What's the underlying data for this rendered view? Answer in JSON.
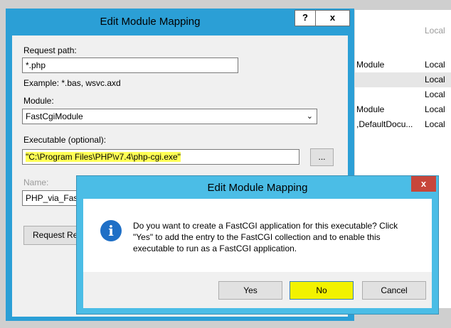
{
  "background_window": {
    "header": "Local",
    "rows": [
      {
        "c1": "Module",
        "c2": "Local"
      },
      {
        "c1": "",
        "c2": "Local"
      },
      {
        "c1": "",
        "c2": "Local"
      },
      {
        "c1": "Module",
        "c2": "Local"
      },
      {
        "c1": ",DefaultDocu...",
        "c2": "Local"
      }
    ]
  },
  "mapping_dialog": {
    "title": "Edit Module Mapping",
    "help_label": "?",
    "close_label": "x",
    "request_path_label": "Request path:",
    "request_path_value": "*.php",
    "example": "Example: *.bas, wsvc.axd",
    "module_label": "Module:",
    "module_value": "FastCgiModule",
    "executable_label": "Executable (optional):",
    "executable_value": "\"C:\\Program Files\\PHP\\v7.4\\php-cgi.exe\"",
    "browse_label": "...",
    "name_label": "Name:",
    "name_value": "PHP_via_FastC",
    "restrictions_label": "Request Res"
  },
  "confirm_dialog": {
    "title": "Edit Module Mapping",
    "close_label": "x",
    "icon": "info-icon",
    "message": "Do you want to create a FastCGI application for this executable? Click \"Yes\" to add the entry to the FastCGI collection and to enable this executable to run as a FastCGI application.",
    "yes_label": "Yes",
    "no_label": "No",
    "cancel_label": "Cancel"
  },
  "colors": {
    "title_bar": "#2b9fd6",
    "confirm_title_bar": "#4bbde6",
    "highlight": "#ffff55",
    "close_red": "#c7463b"
  }
}
